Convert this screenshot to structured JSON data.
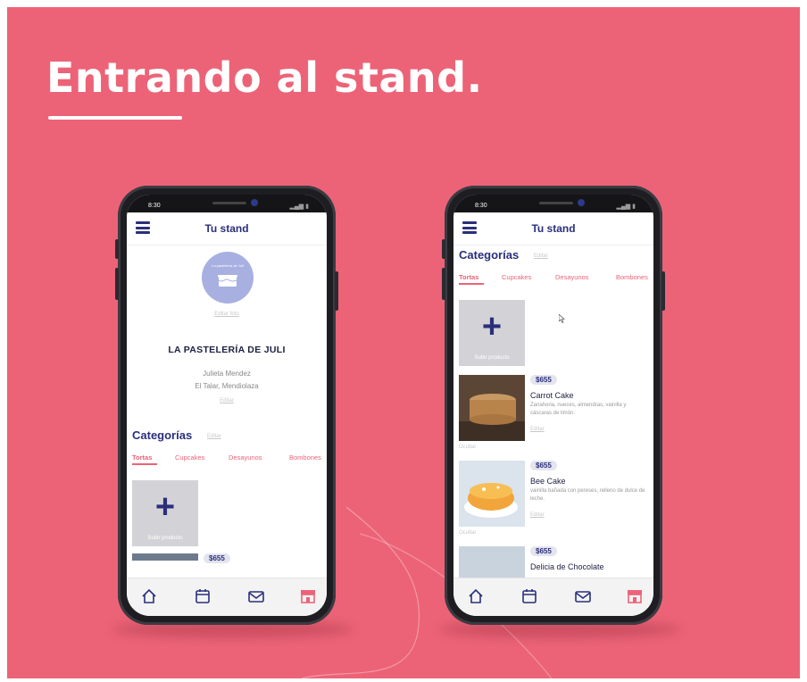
{
  "slide": {
    "headline": "Entrando al stand.",
    "background": "#ec6377",
    "accent_navy": "#2a2f7a",
    "accent_pink": "#ec6377"
  },
  "phone_left": {
    "status_time": "8:30",
    "app_title": "Tu stand",
    "logo_text": "La pastelería de Juli",
    "edit_logo_label": "Editar foto",
    "store_name": "LA PASTELERÍA DE JULI",
    "owner": "Julieta Mendez",
    "location": "El Talar, Mendiolaza",
    "edit_info_label": "Editar",
    "categories_title": "Categorías",
    "categories_edit": "Editar",
    "tabs": [
      "Tortas",
      "Cupcakes",
      "Desayunos",
      "Bombones"
    ],
    "add_product_label": "Subir producto",
    "partial_price": "$655",
    "nav_icons": [
      "home-icon",
      "calendar-icon",
      "mail-icon",
      "store-icon"
    ]
  },
  "phone_right": {
    "status_time": "8:30",
    "app_title": "Tu stand",
    "categories_title": "Categorías",
    "categories_edit": "Editar",
    "tabs": [
      "Tortas",
      "Cupcakes",
      "Desayunos",
      "Bombones"
    ],
    "add_product_label": "Subir producto",
    "products": [
      {
        "price": "$655",
        "name": "Carrot Cake",
        "description": "Zanahoria, nueces, almendras, vainilla y cáscaras de limón.",
        "edit": "Editar",
        "category": "Ocultar"
      },
      {
        "price": "$655",
        "name": "Bee Cake",
        "description": "vainilla bañada con pereses, relleno de dulce de leche.",
        "edit": "Editar",
        "category": "Ocultar"
      },
      {
        "price": "$655",
        "name": "Delicia de Chocolate"
      }
    ],
    "nav_icons": [
      "home-icon",
      "calendar-icon",
      "mail-icon",
      "store-icon"
    ]
  }
}
